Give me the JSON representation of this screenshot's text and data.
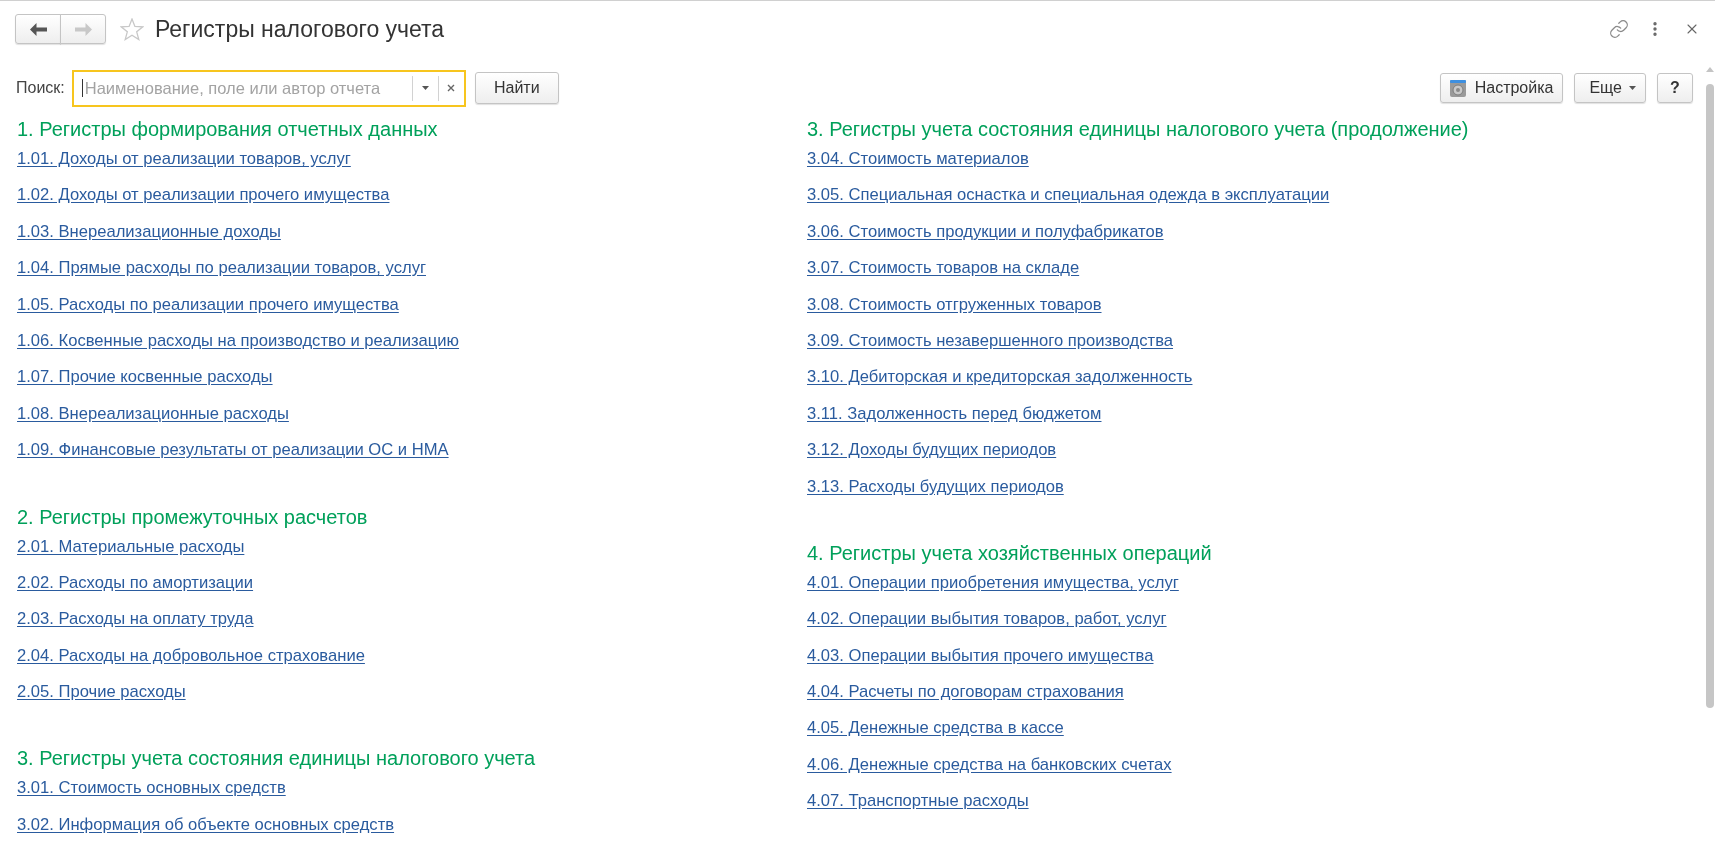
{
  "window": {
    "title": "Регистры налогового учета",
    "favorite": false
  },
  "navigation": [
    {
      "kind": "back",
      "disabled": false
    },
    {
      "kind": "forward",
      "disabled": true
    }
  ],
  "search": {
    "label": "Поиск:",
    "placeholder": "Наименование, поле или автор отчета",
    "focused": true,
    "button": "Найти"
  },
  "toolbar": [
    {
      "kind": "settings",
      "label": "Настройка"
    },
    {
      "kind": "menu",
      "label": "Еще"
    },
    {
      "kind": "help",
      "label": "?"
    }
  ],
  "columns": [
    {
      "sections": [
        {
          "heading": "1. Регистры формирования отчетных данных",
          "links": [
            "1.01. Доходы от реализации товаров, услуг",
            "1.02. Доходы от реализации прочего имущества",
            "1.03. Внереализационные доходы",
            "1.04. Прямые расходы по реализации товаров, услуг",
            "1.05. Расходы по реализации прочего имущества",
            "1.06. Косвенные расходы на производство и реализацию",
            "1.07. Прочие косвенные расходы",
            "1.08. Внереализационные расходы",
            "1.09. Финансовые результаты от реализации ОС и НМА"
          ]
        },
        {
          "heading": "2. Регистры промежуточных расчетов",
          "links": [
            "2.01. Материальные расходы",
            "2.02. Расходы по амортизации",
            "2.03. Расходы на оплату труда",
            "2.04. Расходы на добровольное страхование",
            "2.05. Прочие расходы"
          ]
        },
        {
          "heading": "3. Регистры учета состояния единицы налогового учета",
          "links": [
            "3.01. Стоимость основных средств",
            "3.02. Информация об объекте основных средств"
          ]
        }
      ]
    },
    {
      "sections": [
        {
          "heading": "3. Регистры учета состояния единицы налогового учета (продолжение)",
          "links": [
            "3.04. Стоимость материалов",
            "3.05. Специальная оснастка и специальная одежда в эксплуатации",
            "3.06. Стоимость продукции и полуфабрикатов",
            "3.07. Стоимость товаров на складе",
            "3.08. Стоимость отгруженных товаров",
            "3.09. Стоимость незавершенного производства",
            "3.10. Дебиторская и кредиторская задолженность",
            "3.11. Задолженность перед бюджетом",
            "3.12. Доходы будущих периодов",
            "3.13. Расходы будущих периодов"
          ]
        },
        {
          "heading": "4. Регистры учета хозяйственных операций",
          "links": [
            "4.01. Операции приобретения имущества, услуг",
            "4.02. Операции выбытия товаров, работ, услуг",
            "4.03. Операции выбытия прочего имущества",
            "4.04. Расчеты по договорам страхования",
            "4.05. Денежные средства в кассе",
            "4.06. Денежные средства на банковских счетах",
            "4.07. Транспортные расходы"
          ]
        }
      ]
    }
  ]
}
